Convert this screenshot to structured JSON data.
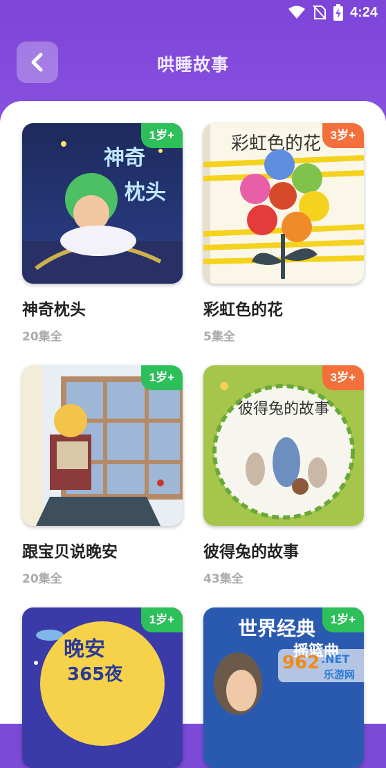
{
  "status_bar": {
    "time": "4:24"
  },
  "header": {
    "title": "哄睡故事"
  },
  "stories": [
    {
      "title": "神奇枕头",
      "count": "20集全",
      "age": "1岁+",
      "badge_color": "#2cbf5a",
      "cover_text": "神奇枕头"
    },
    {
      "title": "彩虹色的花",
      "count": "5集全",
      "age": "3岁+",
      "badge_color": "#f36f3b",
      "cover_text": "彩虹色的花"
    },
    {
      "title": "跟宝贝说晚安",
      "count": "20集全",
      "age": "1岁+",
      "badge_color": "#2cbf5a",
      "cover_text": ""
    },
    {
      "title": "彼得兔的故事",
      "count": "43集全",
      "age": "3岁+",
      "badge_color": "#f36f3b",
      "cover_text": "彼得兔的故事"
    },
    {
      "title": "",
      "count": "",
      "age": "1岁+",
      "badge_color": "#2cbf5a",
      "cover_text": "晚安365夜"
    },
    {
      "title": "",
      "count": "",
      "age": "1岁+",
      "badge_color": "#2cbf5a",
      "cover_text": "世界经典摇篮曲"
    }
  ],
  "watermark": {
    "text": "962.NET",
    "sub": "乐游网"
  }
}
